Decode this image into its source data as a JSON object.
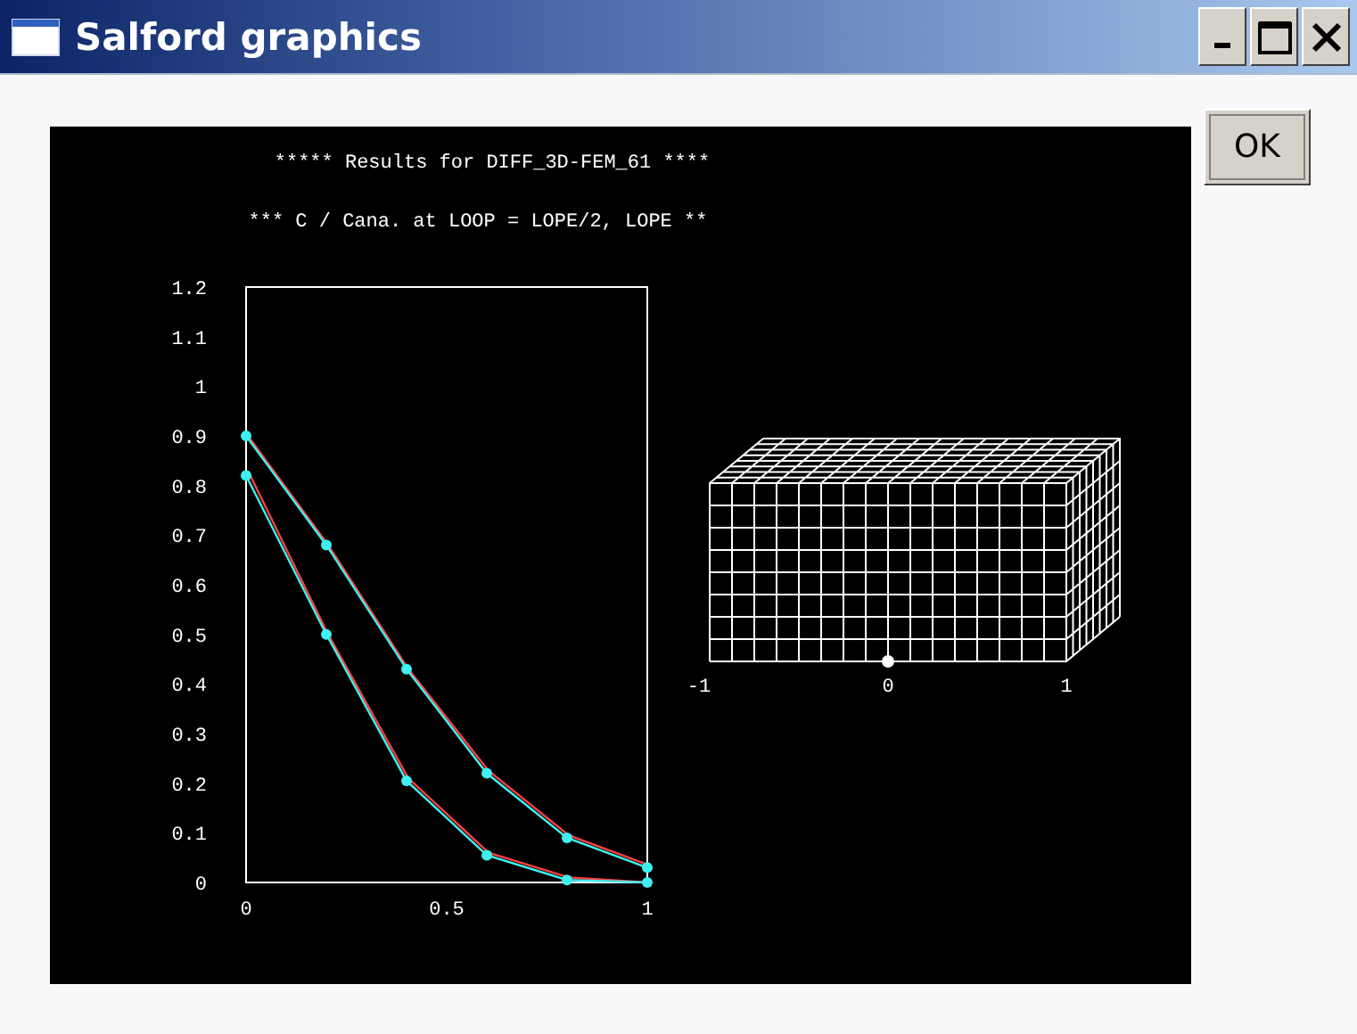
{
  "window": {
    "title": "Salford graphics"
  },
  "ok_button": {
    "label": "OK"
  },
  "plot": {
    "titles": [
      "***** Results for DIFF_3D-FEM_61 ****",
      "*** C / Cana. at LOOP = LOPE/2, LOPE **"
    ],
    "chart_data": {
      "type": "line",
      "x": [
        0,
        0.2,
        0.4,
        0.6,
        0.8,
        1
      ],
      "xlim": [
        0,
        1
      ],
      "ylim": [
        0,
        1.2
      ],
      "xticks": [
        0,
        0.5,
        1
      ],
      "yticks": [
        0,
        0.1,
        0.2,
        0.3,
        0.4,
        0.5,
        0.6,
        0.7,
        0.8,
        0.9,
        1,
        1.1,
        1.2
      ],
      "series": [
        {
          "color": "#ff4040",
          "values": [
            0.9,
            0.68,
            0.43,
            0.225,
            0.095,
            0.035
          ]
        },
        {
          "color": "#40f0f0",
          "marker": "circle",
          "values": [
            0.9,
            0.68,
            0.43,
            0.22,
            0.09,
            0.03
          ]
        },
        {
          "color": "#ff4040",
          "values": [
            0.83,
            0.5,
            0.21,
            0.06,
            0.01,
            0.0
          ]
        },
        {
          "color": "#40f0f0",
          "marker": "circle",
          "values": [
            0.82,
            0.5,
            0.205,
            0.055,
            0.005,
            0.0
          ]
        }
      ]
    }
  },
  "mesh": {
    "axis_labels": [
      "-1",
      "0",
      "1"
    ]
  }
}
